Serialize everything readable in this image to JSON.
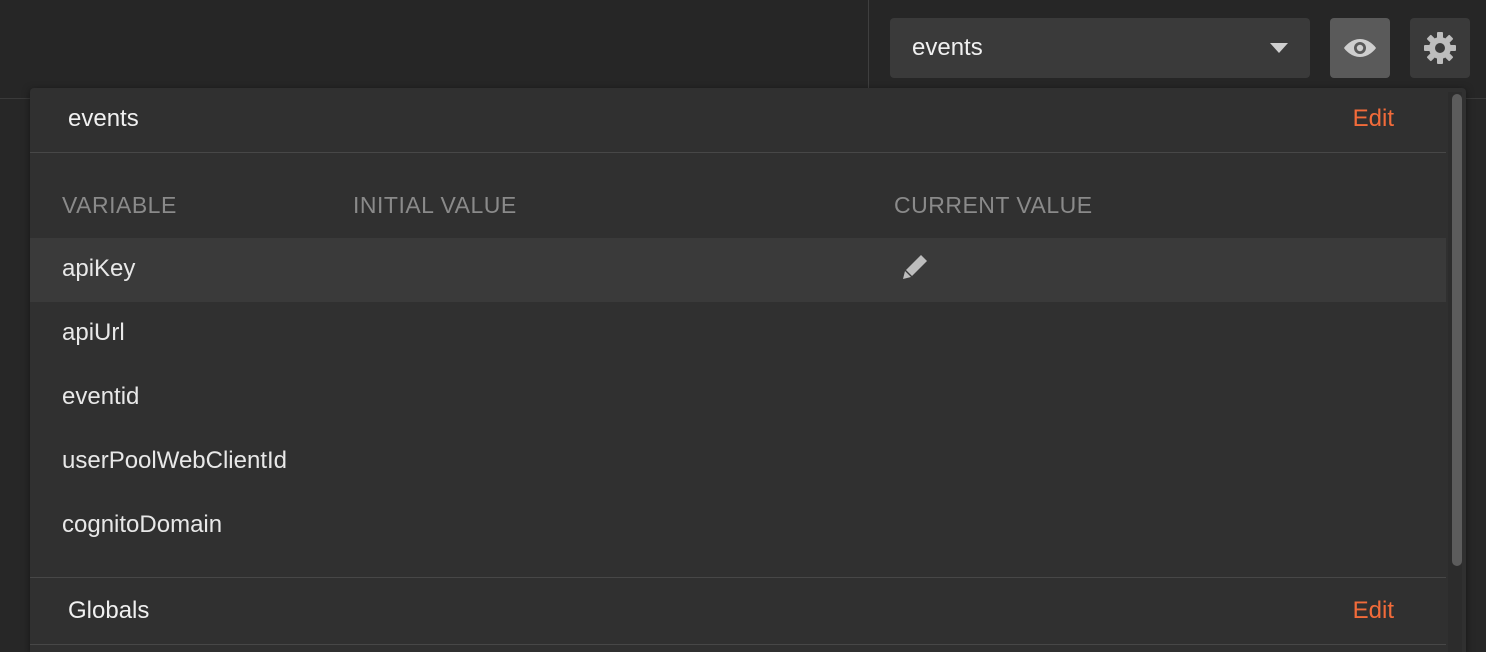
{
  "header": {
    "environment_selected": "events",
    "quicklook_icon": "eye-icon",
    "settings_icon": "gear-icon"
  },
  "quicklook": {
    "sections": [
      {
        "title": "events",
        "edit_label": "Edit"
      },
      {
        "title": "Globals",
        "edit_label": "Edit"
      }
    ],
    "columns": {
      "variable": "VARIABLE",
      "initial_value": "INITIAL VALUE",
      "current_value": "CURRENT VALUE"
    },
    "rows": [
      {
        "variable": "apiKey"
      },
      {
        "variable": "apiUrl"
      },
      {
        "variable": "eventid"
      },
      {
        "variable": "userPoolWebClientId"
      },
      {
        "variable": "cognitoDomain"
      }
    ],
    "edit_icon": "pencil-icon"
  },
  "colors": {
    "accent": "#f26b3a",
    "background": "#272727",
    "panel": "#303030"
  }
}
